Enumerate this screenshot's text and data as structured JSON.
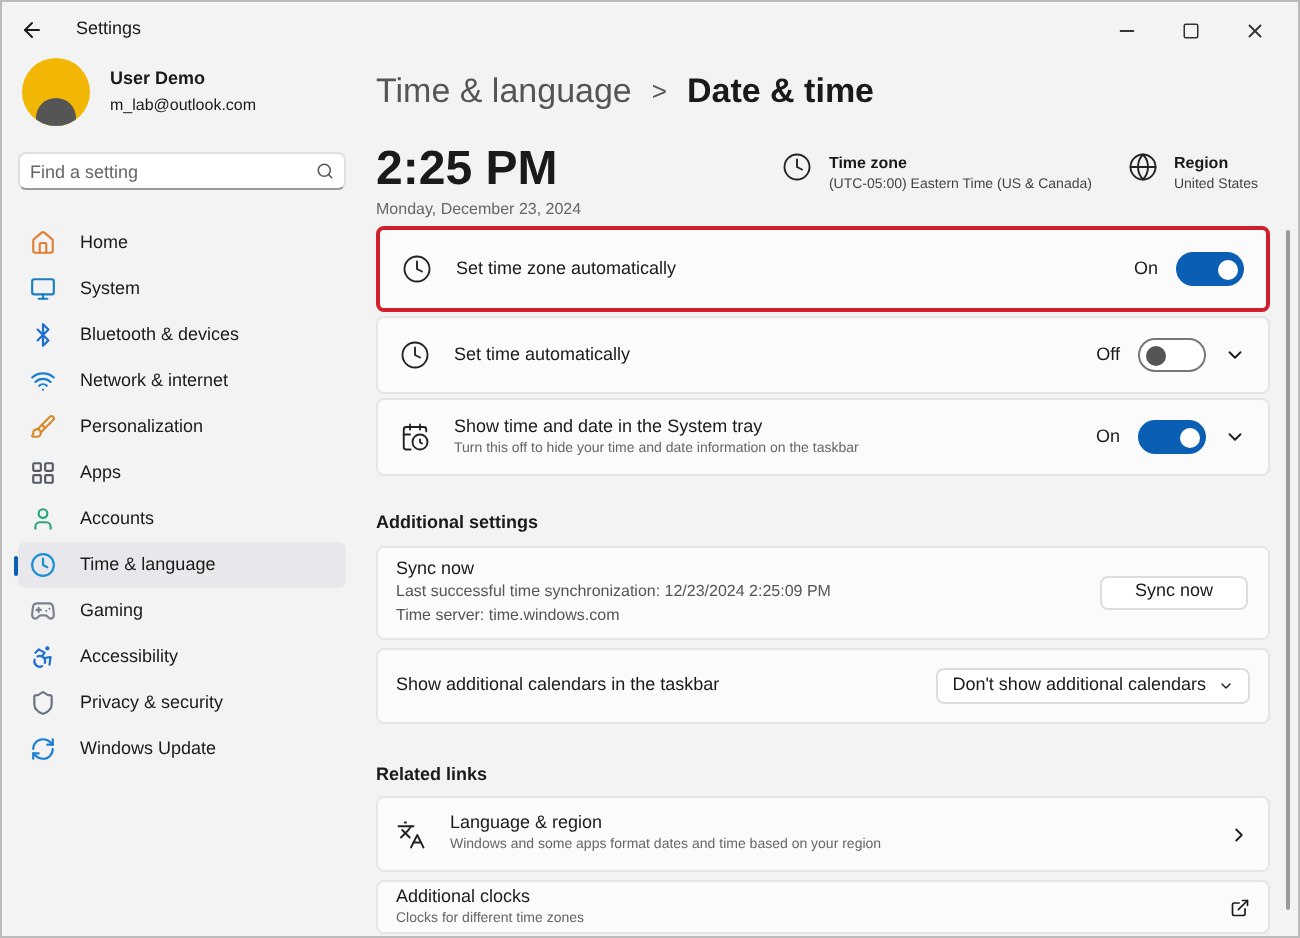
{
  "window": {
    "title": "Settings"
  },
  "user": {
    "name": "User Demo",
    "email": "m_lab@outlook.com"
  },
  "search": {
    "placeholder": "Find a setting"
  },
  "nav": [
    {
      "label": "Home",
      "kind": "home",
      "selected": false
    },
    {
      "label": "System",
      "kind": "system",
      "selected": false
    },
    {
      "label": "Bluetooth & devices",
      "kind": "bluetooth",
      "selected": false
    },
    {
      "label": "Network & internet",
      "kind": "wifi",
      "selected": false
    },
    {
      "label": "Personalization",
      "kind": "brush",
      "selected": false
    },
    {
      "label": "Apps",
      "kind": "apps",
      "selected": false
    },
    {
      "label": "Accounts",
      "kind": "accounts",
      "selected": false
    },
    {
      "label": "Time & language",
      "kind": "time",
      "selected": true
    },
    {
      "label": "Gaming",
      "kind": "gaming",
      "selected": false
    },
    {
      "label": "Accessibility",
      "kind": "accessibility",
      "selected": false
    },
    {
      "label": "Privacy & security",
      "kind": "privacy",
      "selected": false
    },
    {
      "label": "Windows Update",
      "kind": "update",
      "selected": false
    }
  ],
  "breadcrumb": {
    "parent": "Time & language",
    "separator": ">",
    "current": "Date & time"
  },
  "clock": {
    "time": "2:25 PM",
    "date": "Monday, December 23, 2024"
  },
  "info": [
    {
      "kind": "timezone",
      "label": "Time zone",
      "value": "(UTC-05:00) Eastern Time (US & Canada)"
    },
    {
      "kind": "globe",
      "label": "Region",
      "value": "United States"
    }
  ],
  "settings": [
    {
      "kind": "timezone",
      "title": "Set time zone automatically",
      "state": "On",
      "on": true,
      "expandable": false,
      "highlighted": true
    },
    {
      "kind": "clock",
      "title": "Set time automatically",
      "state": "Off",
      "on": false,
      "expandable": true,
      "highlighted": false
    },
    {
      "kind": "calendar",
      "title": "Show time and date in the System tray",
      "subtitle": "Turn this off to hide your time and date information on the taskbar",
      "state": "On",
      "on": true,
      "expandable": true,
      "highlighted": false
    }
  ],
  "additional": {
    "heading": "Additional settings",
    "sync": {
      "title": "Sync now",
      "lines": [
        "Last successful time synchronization: 12/23/2024 2:25:09 PM",
        "Time server: time.windows.com"
      ],
      "button": "Sync now"
    },
    "calendars": {
      "label": "Show additional calendars in the taskbar",
      "value": "Don't show additional calendars"
    }
  },
  "related": {
    "heading": "Related links",
    "links": [
      {
        "kind": "language",
        "title": "Language & region",
        "subtitle": "Windows and some apps format dates and time based on your region"
      },
      {
        "kind": "external",
        "title": "Additional clocks",
        "subtitle": "Clocks for different time zones"
      }
    ]
  }
}
